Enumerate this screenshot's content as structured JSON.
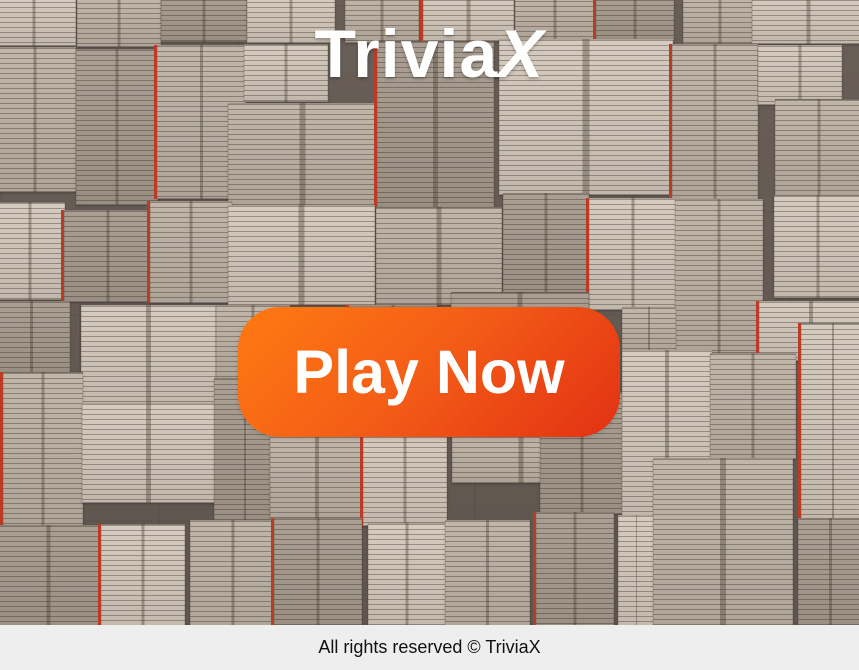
{
  "header": {
    "brand_main": "Trivia",
    "brand_x": "X"
  },
  "main": {
    "play_button_label": "Play Now"
  },
  "footer": {
    "copyright": "All rights reserved © TriviaX"
  },
  "colors": {
    "button_start": "#ff7a12",
    "button_end": "#e23114",
    "footer_background": "#eeeeef",
    "text_light": "#ffffff"
  }
}
